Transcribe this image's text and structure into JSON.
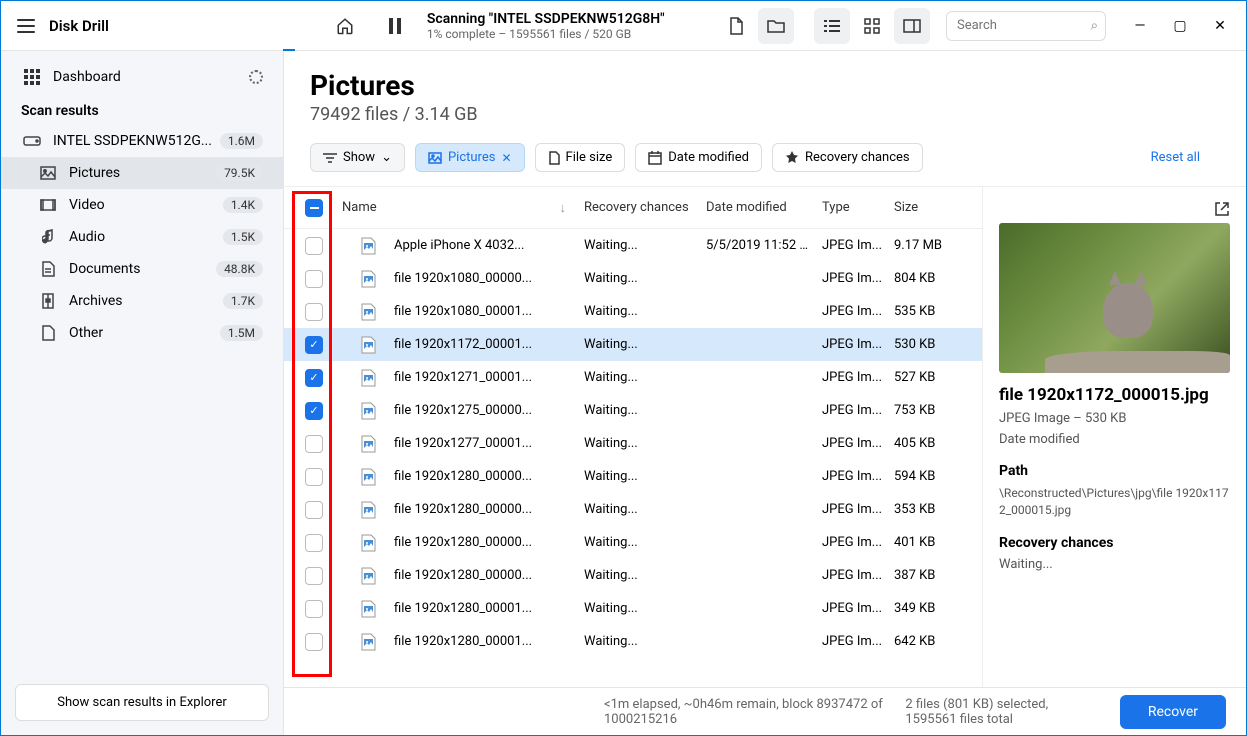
{
  "app": {
    "title": "Disk Drill"
  },
  "scan": {
    "title": "Scanning \"INTEL SSDPEKNW512G8H\"",
    "status": "1% complete – 1595561 files / 520 GB"
  },
  "search": {
    "placeholder": "Search"
  },
  "sidebar": {
    "dashboard": "Dashboard",
    "scan_header": "Scan results",
    "device": {
      "label": "INTEL SSDPEKNW512G...",
      "count": "1.6M"
    },
    "items": [
      {
        "label": "Pictures",
        "count": "79.5K"
      },
      {
        "label": "Video",
        "count": "1.4K"
      },
      {
        "label": "Audio",
        "count": "1.5K"
      },
      {
        "label": "Documents",
        "count": "48.8K"
      },
      {
        "label": "Archives",
        "count": "1.7K"
      },
      {
        "label": "Other",
        "count": "1.5M"
      }
    ],
    "footer_btn": "Show scan results in Explorer"
  },
  "page": {
    "title": "Pictures",
    "sub": "79492 files / 3.14 GB"
  },
  "filters": {
    "show": "Show",
    "pictures": "Pictures",
    "filesize": "File size",
    "datemod": "Date modified",
    "recovery": "Recovery chances",
    "reset": "Reset all"
  },
  "columns": {
    "name": "Name",
    "recovery": "Recovery chances",
    "date": "Date modified",
    "type": "Type",
    "size": "Size"
  },
  "rows": [
    {
      "name": "Apple iPhone X 4032...",
      "rec": "Waiting...",
      "date": "5/5/2019 11:52 A...",
      "type": "JPEG Im...",
      "size": "9.17 MB",
      "checked": false
    },
    {
      "name": "file 1920x1080_00000...",
      "rec": "Waiting...",
      "date": "",
      "type": "JPEG Im...",
      "size": "804 KB",
      "checked": false
    },
    {
      "name": "file 1920x1080_00001...",
      "rec": "Waiting...",
      "date": "",
      "type": "JPEG Im...",
      "size": "535 KB",
      "checked": false
    },
    {
      "name": "file 1920x1172_00001...",
      "rec": "Waiting...",
      "date": "",
      "type": "JPEG Im...",
      "size": "530 KB",
      "checked": true,
      "selected": true
    },
    {
      "name": "file 1920x1271_00001...",
      "rec": "Waiting...",
      "date": "",
      "type": "JPEG Im...",
      "size": "527 KB",
      "checked": true
    },
    {
      "name": "file 1920x1275_00000...",
      "rec": "Waiting...",
      "date": "",
      "type": "JPEG Im...",
      "size": "753 KB",
      "checked": true
    },
    {
      "name": "file 1920x1277_00001...",
      "rec": "Waiting...",
      "date": "",
      "type": "JPEG Im...",
      "size": "405 KB",
      "checked": false
    },
    {
      "name": "file 1920x1280_00000...",
      "rec": "Waiting...",
      "date": "",
      "type": "JPEG Im...",
      "size": "594 KB",
      "checked": false
    },
    {
      "name": "file 1920x1280_00000...",
      "rec": "Waiting...",
      "date": "",
      "type": "JPEG Im...",
      "size": "353 KB",
      "checked": false
    },
    {
      "name": "file 1920x1280_00000...",
      "rec": "Waiting...",
      "date": "",
      "type": "JPEG Im...",
      "size": "401 KB",
      "checked": false
    },
    {
      "name": "file 1920x1280_00000...",
      "rec": "Waiting...",
      "date": "",
      "type": "JPEG Im...",
      "size": "387 KB",
      "checked": false
    },
    {
      "name": "file 1920x1280_00001...",
      "rec": "Waiting...",
      "date": "",
      "type": "JPEG Im...",
      "size": "349 KB",
      "checked": false
    },
    {
      "name": "file 1920x1280_00001...",
      "rec": "Waiting...",
      "date": "",
      "type": "JPEG Im...",
      "size": "642 KB",
      "checked": false
    }
  ],
  "details": {
    "title": "file 1920x1172_000015.jpg",
    "sub": "JPEG Image – 530 KB",
    "datemod_label": "Date modified",
    "path_label": "Path",
    "path": "\\Reconstructed\\Pictures\\jpg\\file 1920x1172_000015.jpg",
    "rec_label": "Recovery chances",
    "rec_value": "Waiting..."
  },
  "bottom": {
    "elapsed": "<1m elapsed, ~0h46m remain, block 8937472 of 1000215216",
    "selected": "2 files (801 KB) selected, 1595561 files total",
    "recover": "Recover"
  }
}
